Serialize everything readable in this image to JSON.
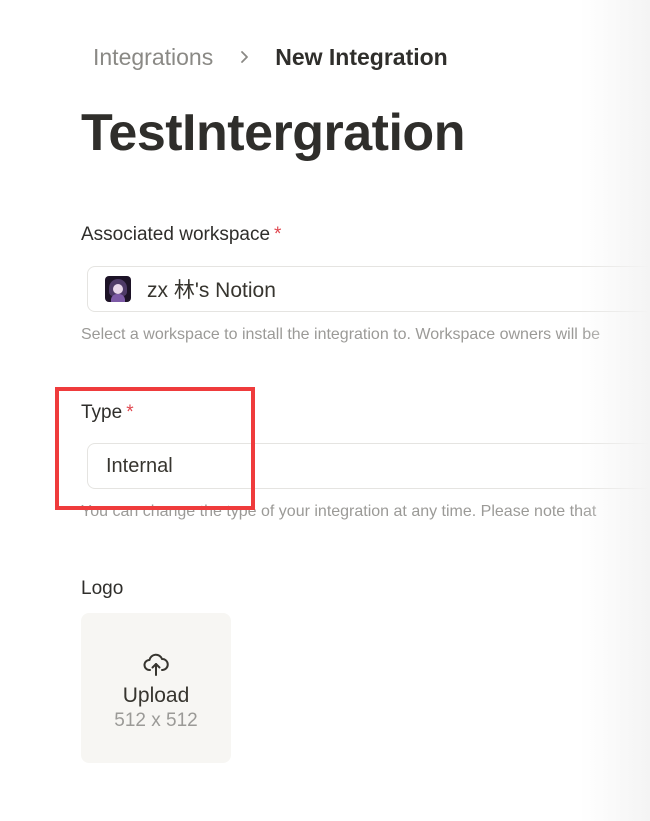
{
  "breadcrumb": {
    "parent": "Integrations",
    "current": "New Integration"
  },
  "title": "TestIntergration",
  "workspace_field": {
    "label": "Associated workspace",
    "required_mark": "*",
    "value": "zx 林's Notion",
    "help": "Select a workspace to install the integration to. Workspace owners will be"
  },
  "type_field": {
    "label": "Type",
    "required_mark": "*",
    "value": "Internal",
    "help": "You can change the type of your integration at any time. Please note that"
  },
  "logo_field": {
    "label": "Logo",
    "upload_label": "Upload",
    "size_hint": "512 x 512"
  },
  "colors": {
    "accent_required": "#e0474f",
    "highlight_frame": "#ef3b3c",
    "upload_bg": "#f7f6f3"
  },
  "icons": {
    "breadcrumb_separator": "chevron-right-icon",
    "upload": "cloud-upload-icon",
    "workspace_avatar": "workspace-avatar-icon"
  }
}
